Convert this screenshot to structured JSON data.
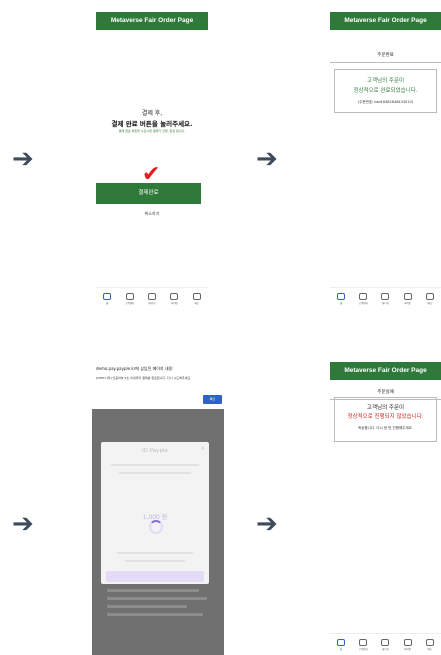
{
  "arrows": [
    "➔",
    "➔",
    "➔",
    "➔"
  ],
  "header": {
    "title": "Metaverse Fair Order Page"
  },
  "tabbar": [
    "홈",
    "고객센터",
    "에너지",
    "마이인",
    "메뉴"
  ],
  "payment_page": {
    "line1": "결제 후,",
    "line2": "결제 완료 버튼을 눌러주세요.",
    "note": "결제 완료 버튼을 누르시면 결제가 진행, 완료 됩니다.",
    "checkmark": "✔",
    "pay_button": "결제완료",
    "cancel_link": "취소하기"
  },
  "order_complete": {
    "subhead": "주문완료",
    "line1": "고객님의 주문이",
    "line2": "정상적으로 완료되었습니다.",
    "order_no": "(주문번호: bsd16482848443010)"
  },
  "pay_popup": {
    "site_text": "demo.pay.payple.kr에 삽입된 페이지 내용:",
    "notice": "[CERT시작] 인증하여 5초 이내까지 결제를 완료합니다. 다시 시도해주세요.",
    "confirm_button": "확인",
    "brand": "ID Payple",
    "amount": "1,000 원",
    "close": "×"
  },
  "order_failed": {
    "subhead": "주문실패",
    "line1": "고객님의 주문이",
    "line2": "정상적으로 진행되지 않았습니다.",
    "line3": "죄송합니다. 다시 한 번 진행해주세요."
  }
}
